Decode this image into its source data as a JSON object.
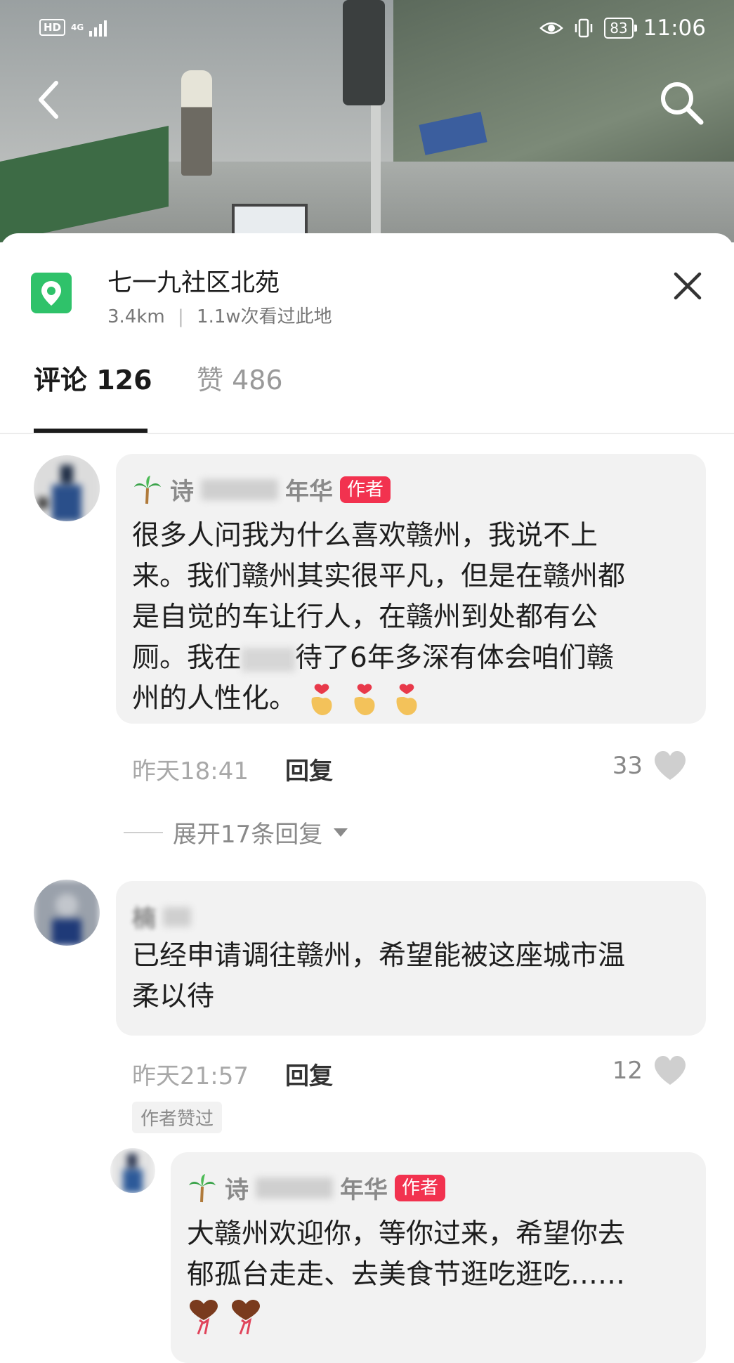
{
  "status_bar": {
    "hd_label": "HD",
    "network": "4G",
    "battery": "83",
    "time": "11:06"
  },
  "location": {
    "title": "七一九社区北苑",
    "distance": "3.4km",
    "separator": "|",
    "views": "1.1w次看过此地"
  },
  "tabs": {
    "comments": "评论 126",
    "likes": "赞 486"
  },
  "comments": [
    {
      "name_left": "诗",
      "name_right": "年华",
      "badge": "作者",
      "lines": [
        "很多人问我为什么喜欢赣州，我说不上",
        "来。我们赣州其实很平凡，但是在赣州都",
        "是自觉的车让行人，在赣州到处都有公",
        "厕。我在",
        "待了6年多深有体会咱们赣",
        "州的人性化。"
      ],
      "time": "昨天18:41",
      "reply_label": "回复",
      "likes": "33",
      "expand_label": "展开17条回复"
    },
    {
      "name_blurred": "楠",
      "lines": [
        "已经申请调往赣州，希望能被这座城市温",
        "柔以待"
      ],
      "time": "昨天21:57",
      "reply_label": "回复",
      "likes": "12",
      "liked_chip": "作者赞过"
    }
  ],
  "reply": {
    "name_left": "诗",
    "name_right": "年华",
    "badge": "作者",
    "lines": [
      "大赣州欢迎你，等你过来，希望你去",
      "郁孤台走走、去美食节逛吃逛吃……"
    ]
  }
}
